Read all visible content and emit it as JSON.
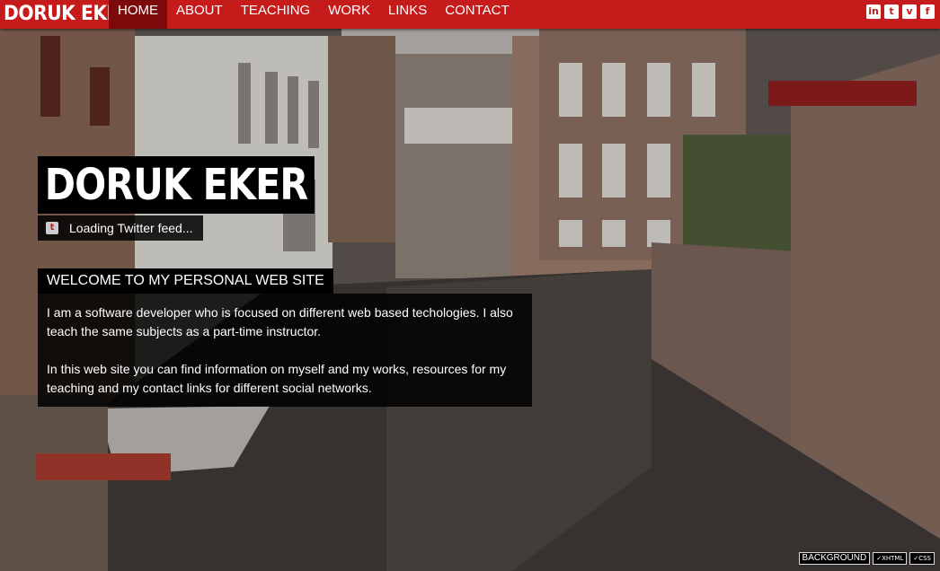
{
  "site": {
    "brand": "DORUK EKER"
  },
  "nav": {
    "items": [
      {
        "label": "HOME",
        "active": true
      },
      {
        "label": "ABOUT",
        "active": false
      },
      {
        "label": "TEACHING",
        "active": false
      },
      {
        "label": "WORK",
        "active": false
      },
      {
        "label": "LINKS",
        "active": false
      },
      {
        "label": "CONTACT",
        "active": false
      }
    ]
  },
  "social": [
    {
      "icon": "linkedin-icon",
      "glyph": "in"
    },
    {
      "icon": "twitter-icon",
      "glyph": "t"
    },
    {
      "icon": "vimeo-icon",
      "glyph": "v"
    },
    {
      "icon": "facebook-icon",
      "glyph": "f"
    }
  ],
  "hero": {
    "name": "DORUK EKER",
    "twitter_status": "Loading Twitter feed...",
    "twitter_glyph": "t"
  },
  "welcome": {
    "title": "WELCOME TO MY PERSONAL WEB SITE",
    "paragraphs": [
      "I am a software developer who is focused on different web based techologies. I also teach the same subjects as a part-time instructor.",
      "In this web site you can find information on myself and my works, resources for my teaching and my contact links for different social networks."
    ]
  },
  "footer": {
    "background_label": "BACKGROUND",
    "xhtml_label": "✓XHTML",
    "css_label": "✓CSS"
  },
  "colors": {
    "accent": "#c51b1b",
    "active_nav": "#7c0a0a"
  }
}
